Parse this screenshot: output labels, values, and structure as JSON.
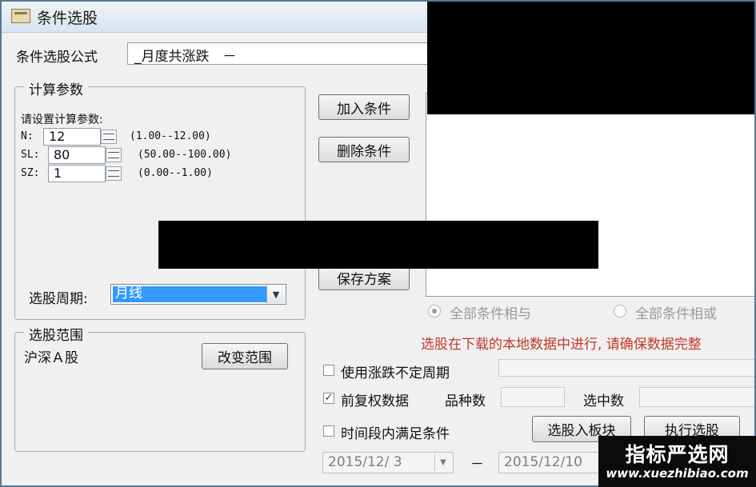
{
  "window": {
    "title": "条件选股"
  },
  "formula": {
    "label": "条件选股公式",
    "value": "_月度共涨跌　－"
  },
  "params": {
    "group_title": "计算参数",
    "prompt": "请设置计算参数:",
    "rows": [
      {
        "name": "N:",
        "value": "12",
        "range": "(1.00--12.00)"
      },
      {
        "name": "SL:",
        "value": "80",
        "range": "(50.00--100.00)"
      },
      {
        "name": "SZ:",
        "value": "1",
        "range": "(0.00--1.00)"
      }
    ],
    "period_label": "选股周期:",
    "period_value": "月线"
  },
  "buttons": {
    "add": "加入条件",
    "delete": "删除条件",
    "save": "保存方案",
    "change_range": "改变范围",
    "to_block": "选股入板块",
    "execute": "执行选股"
  },
  "range": {
    "group_title": "选股范围",
    "value": "沪深Ａ股"
  },
  "logic": {
    "all_and": "全部条件相与",
    "all_or": "全部条件相或"
  },
  "notice": "选股在下载的本地数据中进行, 请确保数据完整",
  "options": {
    "variable_period": "使用涨跌不定周期",
    "forward_adjust": "前复权数据",
    "time_period": "时间段内满足条件"
  },
  "stats": {
    "variety_label": "品种数",
    "selected_label": "选中数"
  },
  "dates": {
    "start": "2015/12/ 3",
    "dash": "－",
    "end": "2015/12/10"
  },
  "watermark": {
    "cn": "指标严选网",
    "en": "www.xuezhibiao.com"
  },
  "colors": {
    "notice": "#c0392b",
    "selection": "#3399ff",
    "redaction": "#000000"
  }
}
